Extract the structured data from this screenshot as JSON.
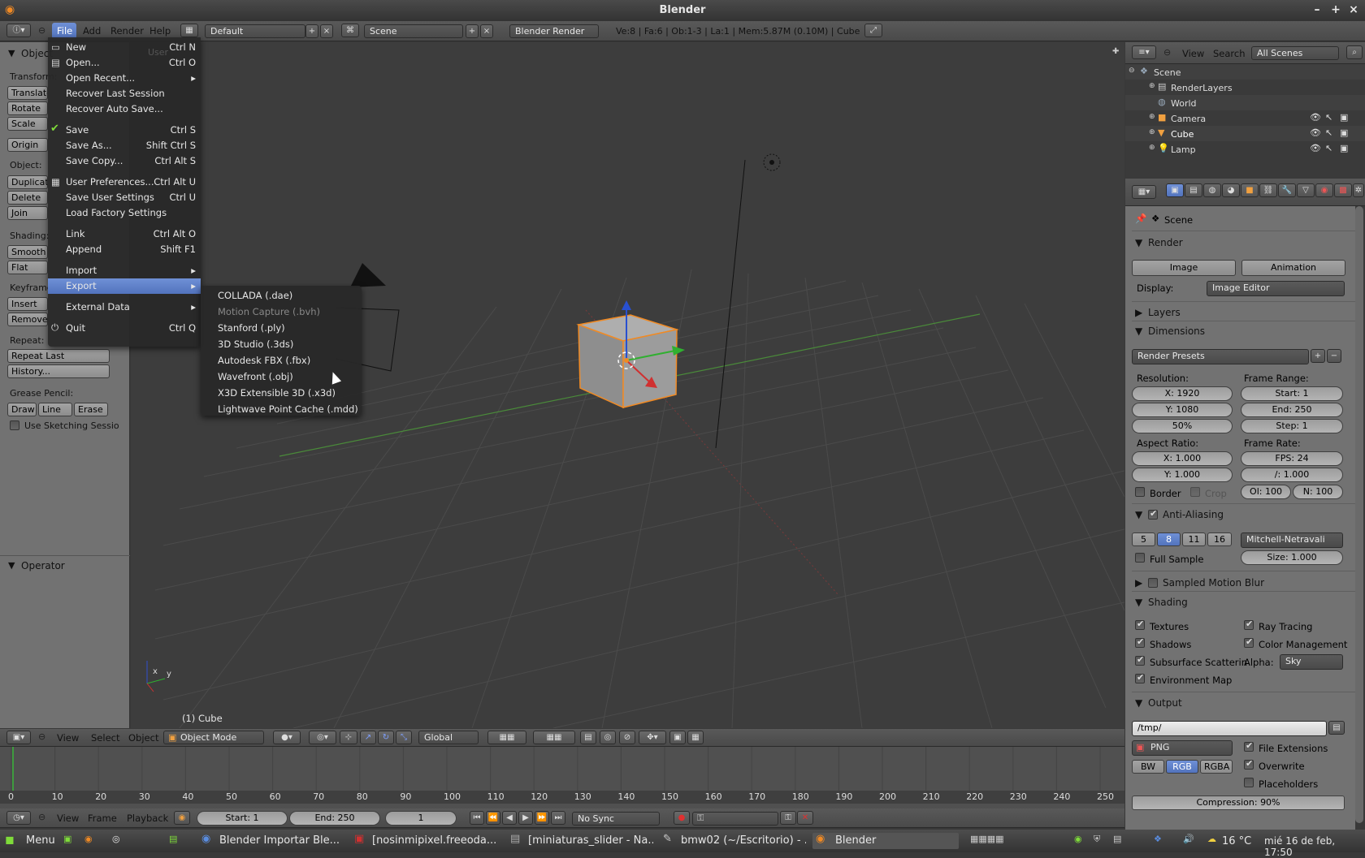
{
  "app_title": "Blender",
  "header": {
    "menus": [
      "File",
      "Add",
      "Render",
      "Help"
    ],
    "layout": "Default",
    "scene": "Scene",
    "engine": "Blender Render",
    "stats": "Ve:8 | Fa:6 | Ob:1-3 | La:1 | Mem:5.87M (0.10M) | Cube"
  },
  "left_panel": {
    "object": "Object",
    "transform": "Transform:",
    "translate": "Translate",
    "rotate": "Rotate",
    "scale": "Scale",
    "origin": "Origin",
    "object_label": "Object:",
    "duplicate": "Duplicate",
    "delete": "Delete",
    "join": "Join",
    "shading": "Shading:",
    "smooth": "Smooth",
    "flat": "Flat",
    "keyframes": "Keyframes:",
    "insert": "Insert",
    "remove": "Remove",
    "repeat": "Repeat:",
    "repeat_last": "Repeat Last",
    "history": "History...",
    "grease_pencil": "Grease Pencil:",
    "draw": "Draw",
    "line": "Line",
    "erase": "Erase",
    "use_sketching": "Use Sketching Sessio",
    "operator": "Operator"
  },
  "file_menu": [
    {
      "label": "New",
      "shortcut": "Ctrl N"
    },
    {
      "label": "Open...",
      "shortcut": "Ctrl O"
    },
    {
      "label": "Open Recent...",
      "shortcut": ""
    },
    {
      "label": "Recover Last Session",
      "shortcut": ""
    },
    {
      "label": "Recover Auto Save...",
      "shortcut": ""
    },
    {
      "label": "Save",
      "shortcut": "Ctrl S"
    },
    {
      "label": "Save As...",
      "shortcut": "Shift Ctrl S"
    },
    {
      "label": "Save Copy...",
      "shortcut": "Ctrl Alt S"
    },
    {
      "label": "User Preferences...",
      "shortcut": "Ctrl Alt U"
    },
    {
      "label": "Save User Settings",
      "shortcut": "Ctrl U"
    },
    {
      "label": "Load Factory Settings",
      "shortcut": ""
    },
    {
      "label": "Link",
      "shortcut": "Ctrl Alt O"
    },
    {
      "label": "Append",
      "shortcut": "Shift F1"
    },
    {
      "label": "Import",
      "shortcut": ""
    },
    {
      "label": "Export",
      "shortcut": ""
    },
    {
      "label": "External Data",
      "shortcut": ""
    },
    {
      "label": "Quit",
      "shortcut": "Ctrl Q"
    }
  ],
  "export_menu": [
    "COLLADA (.dae)",
    "Motion Capture (.bvh)",
    "Stanford (.ply)",
    "3D Studio (.3ds)",
    "Autodesk FBX (.fbx)",
    "Wavefront (.obj)",
    "X3D Extensible 3D (.x3d)",
    "Lightwave Point Cache (.mdd)"
  ],
  "ghost_label": "User",
  "viewport": {
    "object_label": "(1) Cube",
    "axis_x": "x",
    "axis_y": "y"
  },
  "view3d_header": {
    "view": "View",
    "select": "Select",
    "object": "Object",
    "mode": "Object Mode",
    "orientation": "Global"
  },
  "outliner": {
    "view": "View",
    "search": "Search",
    "scenes": "All Scenes",
    "items": [
      "Scene",
      "RenderLayers",
      "World",
      "Camera",
      "Cube",
      "Lamp"
    ]
  },
  "properties": {
    "context": "Scene",
    "render": "Render",
    "image": "Image",
    "animation": "Animation",
    "display": "Display:",
    "display_value": "Image Editor",
    "layers": "Layers",
    "dimensions": "Dimensions",
    "render_presets": "Render Presets",
    "resolution": "Resolution:",
    "res_x": "X: 1920",
    "res_y": "Y: 1080",
    "res_pct": "50%",
    "frame_range": "Frame Range:",
    "start": "Start: 1",
    "end": "End: 250",
    "step": "Step: 1",
    "aspect": "Aspect Ratio:",
    "aspect_x": "X: 1.000",
    "aspect_y": "Y: 1.000",
    "frame_rate": "Frame Rate:",
    "fps": "FPS: 24",
    "fps_base": "/: 1.000",
    "border": "Border",
    "crop": "Crop",
    "old": "Ol: 100",
    "new": "N: 100",
    "anti_aliasing": "Anti-Aliasing",
    "aa_samples": [
      "5",
      "8",
      "11",
      "16"
    ],
    "filter": "Mitchell-Netravali",
    "full_sample": "Full Sample",
    "size": "Size: 1.000",
    "motion_blur": "Sampled Motion Blur",
    "shading": "Shading",
    "textures": "Textures",
    "ray_tracing": "Ray Tracing",
    "shadows": "Shadows",
    "color_management": "Color Management",
    "sss": "Subsurface Scatterin",
    "alpha": "Alpha:",
    "alpha_value": "Sky",
    "env_map": "Environment Map",
    "output": "Output",
    "path": "/tmp/",
    "format": "PNG",
    "file_ext": "File Extensions",
    "overwrite": "Overwrite",
    "placeholders": "Placeholders",
    "bw": "BW",
    "rgb": "RGB",
    "rgba": "RGBA",
    "compression": "Compression: 90%"
  },
  "timeline": {
    "ticks": [
      "0",
      "10",
      "20",
      "30",
      "40",
      "50",
      "60",
      "70",
      "80",
      "90",
      "100",
      "110",
      "120",
      "130",
      "140",
      "150",
      "160",
      "170",
      "180",
      "190",
      "200",
      "210",
      "220",
      "230",
      "240",
      "250"
    ],
    "view": "View",
    "frame": "Frame",
    "playback": "Playback",
    "start": "Start: 1",
    "end": "End: 250",
    "current": "1",
    "sync": "No Sync"
  },
  "taskbar": {
    "menu": "Menu",
    "tasks": [
      "Blender Importar Ble...",
      "[nosinmipixel.freeoda....",
      "[miniaturas_slider - Na...",
      "bmw02 (~/Escritorio) - ...",
      "Blender"
    ],
    "weather": "16 °C",
    "clock": "mié 16 de feb, 17:50"
  },
  "colors": {
    "accent": "#5680c2",
    "select_orange": "#f08a24"
  }
}
